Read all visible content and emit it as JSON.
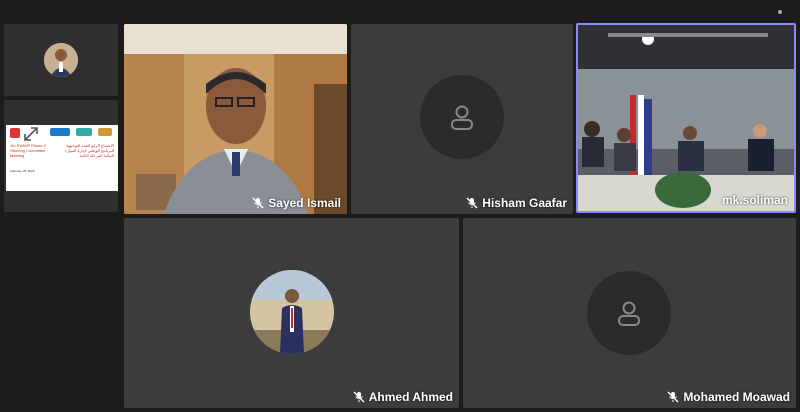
{
  "participants": {
    "sayed": {
      "name": "Sayed Ismail"
    },
    "hisham": {
      "name": "Hisham Gaafar"
    },
    "soliman": {
      "name": "mk.soliman"
    },
    "ahmed": {
      "name": "Ahmed Ahmed"
    },
    "mohamed": {
      "name": "Mohamed Moawad"
    }
  },
  "shared_slide": {
    "title_en": "4th PWMIP Phase 2 Steering Committee Meeting",
    "date_en": "February 25, 2022",
    "title_ar": "الاجتماع الرابع للجنة التوجيهية للبرنامج الوطني لإدارة الموارد المائية المرحلة الثانية"
  },
  "icons": {
    "mic_off": "mic-off-icon",
    "person": "person-icon",
    "expand": "expand-icon",
    "menu": "menu-dots-icon"
  },
  "colors": {
    "background": "#1c1c1c",
    "tile": "#3c3c3c",
    "active_speaker_border": "#8a8aff"
  }
}
